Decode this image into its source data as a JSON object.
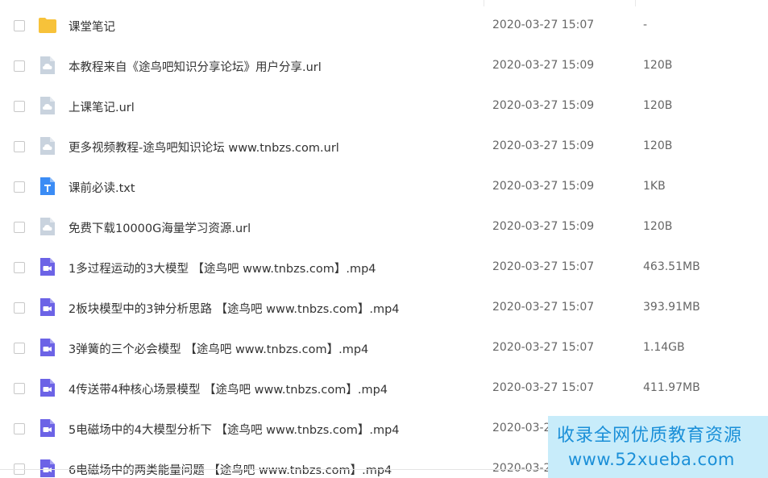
{
  "files": [
    {
      "type": "folder",
      "icon": "folder-icon",
      "name": "课堂笔记",
      "date": "2020-03-27 15:07",
      "size": "-"
    },
    {
      "type": "url",
      "icon": "cloud-link-icon",
      "name": "本教程来自《途鸟吧知识分享论坛》用户分享.url",
      "date": "2020-03-27 15:09",
      "size": "120B"
    },
    {
      "type": "url",
      "icon": "cloud-link-icon",
      "name": "上课笔记.url",
      "date": "2020-03-27 15:09",
      "size": "120B"
    },
    {
      "type": "url",
      "icon": "cloud-link-icon",
      "name": "更多视频教程-途鸟吧知识论坛 www.tnbzs.com.url",
      "date": "2020-03-27 15:09",
      "size": "120B"
    },
    {
      "type": "txt",
      "icon": "text-file-icon",
      "name": "课前必读.txt",
      "date": "2020-03-27 15:09",
      "size": "1KB"
    },
    {
      "type": "url",
      "icon": "cloud-link-icon",
      "name": "免费下载10000G海量学习资源.url",
      "date": "2020-03-27 15:09",
      "size": "120B"
    },
    {
      "type": "video",
      "icon": "video-file-icon",
      "name": "1多过程运动的3大模型 【途鸟吧 www.tnbzs.com】.mp4",
      "date": "2020-03-27 15:07",
      "size": "463.51MB"
    },
    {
      "type": "video",
      "icon": "video-file-icon",
      "name": "2板块模型中的3钟分析思路 【途鸟吧 www.tnbzs.com】.mp4",
      "date": "2020-03-27 15:07",
      "size": "393.91MB"
    },
    {
      "type": "video",
      "icon": "video-file-icon",
      "name": "3弹簧的三个必会模型 【途鸟吧 www.tnbzs.com】.mp4",
      "date": "2020-03-27 15:07",
      "size": "1.14GB"
    },
    {
      "type": "video",
      "icon": "video-file-icon",
      "name": "4传送带4种核心场景模型 【途鸟吧 www.tnbzs.com】.mp4",
      "date": "2020-03-27 15:07",
      "size": "411.97MB"
    },
    {
      "type": "video",
      "icon": "video-file-icon",
      "name": "5电磁场中的4大模型分析下 【途鸟吧 www.tnbzs.com】.mp4",
      "date": "2020-03-27 15:07",
      "size": ""
    },
    {
      "type": "video",
      "icon": "video-file-icon",
      "name": "6电磁场中的两类能量问题 【途鸟吧 www.tnbzs.com】.mp4",
      "date": "2020-03-27 15:07",
      "size": ""
    }
  ],
  "watermark": {
    "line1": "收录全网优质教育资源",
    "line2": "www.52xueba.com"
  },
  "colors": {
    "folder": "#f7c23a",
    "cloud": "#c9d3de",
    "txt": "#3b8cf5",
    "video": "#6c63e6",
    "watermark_bg": "#c8ecfa",
    "watermark_text": "#1a8fd8"
  }
}
